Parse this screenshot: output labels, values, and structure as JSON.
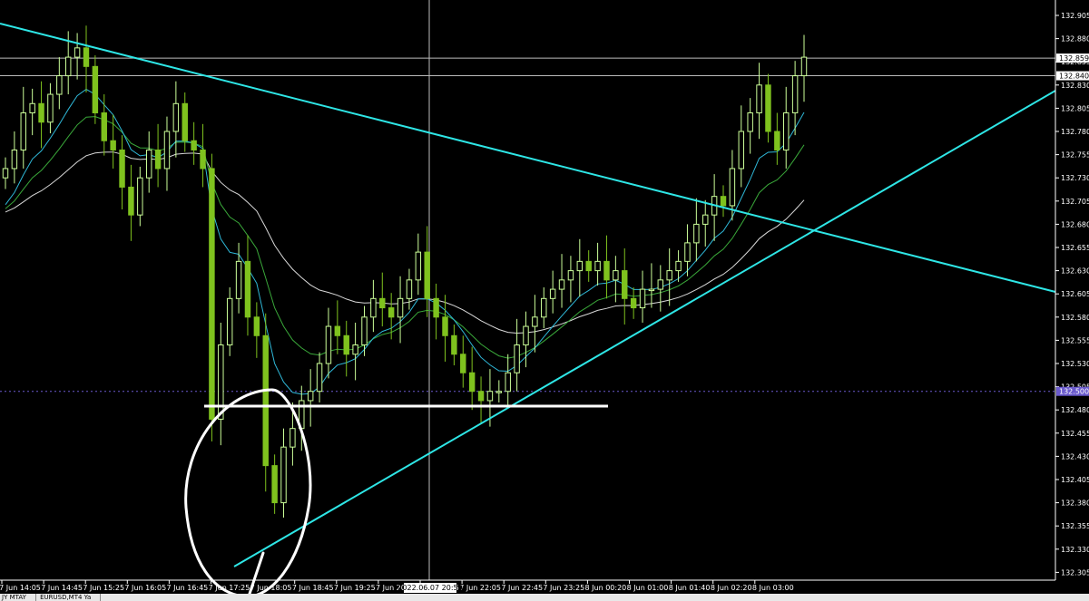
{
  "chart_data": {
    "type": "candlestick",
    "symbol_tabs": [
      "JY MTAY",
      "EURUSD,MT4 Ya"
    ],
    "colors": {
      "background": "#000000",
      "bull_candle": "#ccff99",
      "bear_candle": "#7fc21e",
      "ma_white": "#d8d8d8",
      "ma_cyan": "#2fb8d8",
      "ma_green": "#3aa83a",
      "trendline": "#2ee6e6",
      "drawing": "#ffffff",
      "last_price_tag": "#6a5acd"
    },
    "y_ticks": [
      "132.905",
      "132.880",
      "132.855",
      "132.830",
      "132.805",
      "132.780",
      "132.755",
      "132.730",
      "132.705",
      "132.680",
      "132.655",
      "132.630",
      "132.605",
      "132.580",
      "132.555",
      "132.530",
      "132.505",
      "132.480",
      "132.455",
      "132.430",
      "132.405",
      "132.380",
      "132.355",
      "132.330",
      "132.305"
    ],
    "price_tags": [
      {
        "label": "132.859",
        "value": 132.859
      },
      {
        "label": "132.840",
        "value": 132.84
      },
      {
        "label": "132.500",
        "value": 132.5
      }
    ],
    "x_ticks": [
      "7 Jun 14:05",
      "7 Jun 14:45",
      "7 Jun 15:25",
      "7 Jun 16:05",
      "7 Jun 16:45",
      "7 Jun 17:25",
      "7 Jun 18:05",
      "7 Jun 18:45",
      "7 Jun 19:25",
      "7 Jun 20:05",
      "7 Jun 21:25",
      "7 Jun 22:05",
      "7 Jun 22:45",
      "7 Jun 23:25",
      "8 Jun 00:20",
      "8 Jun 01:00",
      "8 Jun 01:40",
      "8 Jun 02:20",
      "8 Jun 03:00"
    ],
    "crosshair_label": "2022.06.07 20:50",
    "candles_close": [
      132.74,
      132.76,
      132.8,
      132.81,
      132.79,
      132.82,
      132.84,
      132.86,
      132.87,
      132.85,
      132.8,
      132.77,
      132.76,
      132.72,
      132.69,
      132.73,
      132.76,
      132.74,
      132.78,
      132.81,
      132.77,
      132.76,
      132.74,
      132.47,
      132.55,
      132.6,
      132.64,
      132.58,
      132.56,
      132.42,
      132.38,
      132.44,
      132.46,
      132.49,
      132.5,
      132.53,
      132.57,
      132.56,
      132.54,
      132.55,
      132.58,
      132.6,
      132.59,
      132.58,
      132.6,
      132.62,
      132.65,
      132.6,
      132.58,
      132.56,
      132.54,
      132.52,
      132.5,
      132.49,
      132.5,
      132.5,
      132.52,
      132.55,
      132.57,
      132.58,
      132.6,
      132.61,
      132.62,
      132.63,
      132.64,
      132.63,
      132.64,
      132.62,
      132.63,
      132.6,
      132.59,
      132.61,
      132.61,
      132.62,
      132.63,
      132.64,
      132.66,
      132.68,
      132.69,
      132.71,
      132.7,
      132.74,
      132.78,
      132.8,
      132.83,
      132.78,
      132.76,
      132.8,
      132.84,
      132.86
    ],
    "annotations": [
      "descending trendline",
      "ascending trendline",
      "horizontal support line",
      "hand-drawn circle"
    ]
  }
}
